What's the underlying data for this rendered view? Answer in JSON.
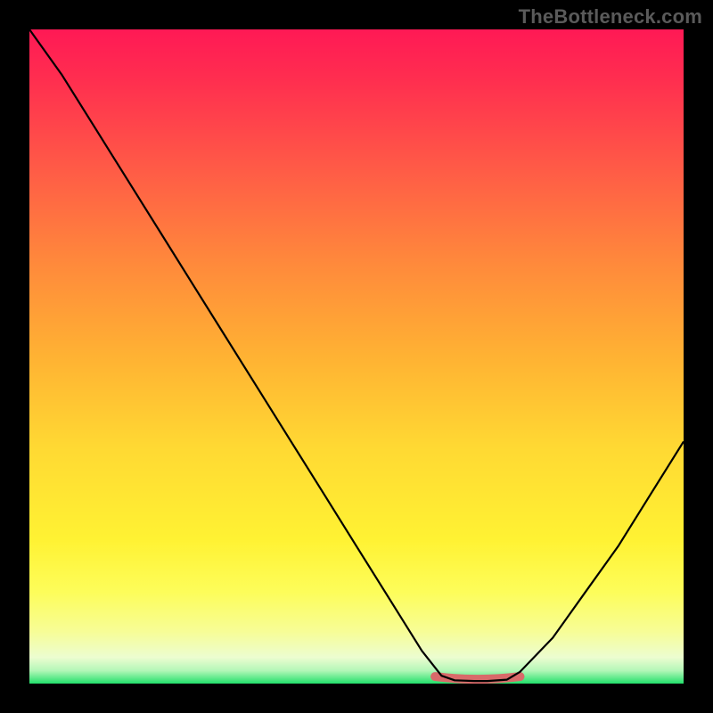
{
  "watermark": "TheBottleneck.com",
  "chart_data": {
    "type": "line",
    "title": "",
    "xlabel": "",
    "ylabel": "",
    "xlim": [
      0,
      100
    ],
    "ylim": [
      0,
      100
    ],
    "grid": false,
    "background_gradient": {
      "top": "#ff1955",
      "mid": "#ffd933",
      "bottom_band": "#22e06b"
    },
    "series": [
      {
        "name": "bottleneck-curve",
        "color": "#000000",
        "x": [
          0,
          5,
          10,
          15,
          20,
          25,
          30,
          35,
          40,
          45,
          50,
          55,
          60,
          63,
          65,
          68,
          70,
          73,
          75,
          80,
          85,
          90,
          95,
          100
        ],
        "values": [
          100,
          93,
          85,
          77,
          69,
          61,
          53,
          45,
          37,
          29,
          21,
          13,
          5,
          1.2,
          0.5,
          0.4,
          0.4,
          0.6,
          1.8,
          7,
          14,
          21,
          29,
          37
        ]
      }
    ],
    "highlight_segment": {
      "name": "optimal-range-marker",
      "color": "#d96a6a",
      "x_start": 62,
      "x_end": 75,
      "y": 0.8
    }
  }
}
